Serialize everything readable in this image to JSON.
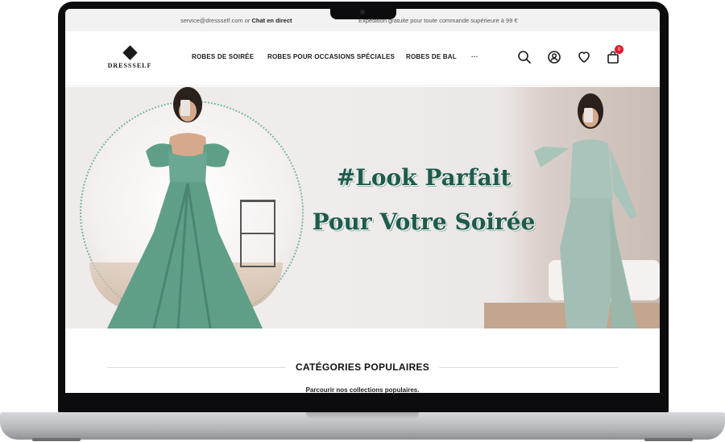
{
  "topbar": {
    "email": "service@dressself.com",
    "or": "or",
    "chat": "Chat en direct",
    "shipping": "Expédition gratuite pour toute commande supérieure à 99 €"
  },
  "brand": {
    "name": "DRESSSELF"
  },
  "nav": {
    "items": [
      {
        "label": "ROBES DE SOIRÉE"
      },
      {
        "label": "ROBES POUR OCCASIONS SPÉCIALES"
      },
      {
        "label": "ROBES DE BAL"
      },
      {
        "label": "···"
      }
    ]
  },
  "header_icons": {
    "search": "search-icon",
    "account": "user-circle-icon",
    "wishlist": "heart-icon",
    "cart": "shopping-bag-icon",
    "cart_count": "0"
  },
  "hero": {
    "line1": "#Look Parfait",
    "line2": "Pour Votre Soirée"
  },
  "categories": {
    "title": "CATÉGORIES POPULAIRES",
    "subtitle": "Parcourir nos collections populaires."
  },
  "colors": {
    "accent": "#1e5b4d",
    "badge": "#e0182d",
    "dress": "#5f9f88"
  }
}
